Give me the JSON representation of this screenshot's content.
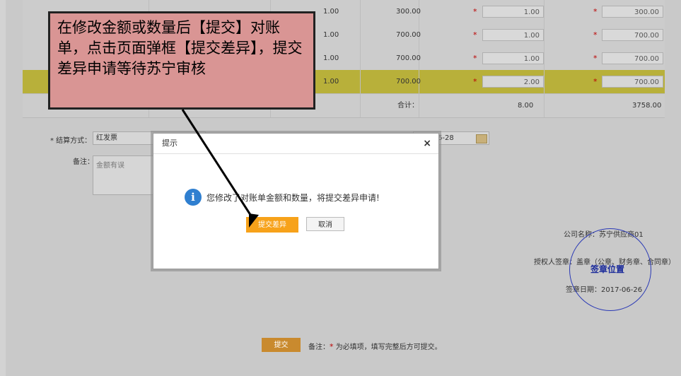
{
  "table": {
    "rows": [
      {
        "qty": "1.00",
        "amount": "300.00",
        "qty_input": "1.00",
        "amount_input": "300.00",
        "highlight": false
      },
      {
        "qty": "1.00",
        "amount": "700.00",
        "qty_input": "1.00",
        "amount_input": "700.00",
        "highlight": false
      },
      {
        "qty": "1.00",
        "amount": "700.00",
        "qty_input": "1.00",
        "amount_input": "700.00",
        "highlight": false
      },
      {
        "qty": "1.00",
        "amount": "700.00",
        "qty_input": "2.00",
        "amount_input": "700.00",
        "highlight": true
      }
    ],
    "total_label": "合计：",
    "total_qty": "8.00",
    "total_amount": "3758.00",
    "required_mark": "*"
  },
  "form": {
    "settle_label": "* 结算方式：",
    "settle_value": "红发票",
    "date_value": "6-28",
    "remark_label": "备注：",
    "remark_value": "金额有误"
  },
  "company": {
    "name_label": "公司名称：苏宁供应商01",
    "sign_label": "授权人签章：盖章（公章、财务章、合同章）",
    "seal_text": "签章位置",
    "sign_date": "签章日期：2017-06-26"
  },
  "footer": {
    "submit_label": "提交",
    "note_label": "备注：",
    "note_required": "*",
    "note_text": "为必填项，填写完整后方可提交。"
  },
  "dialog": {
    "title": "提示",
    "close": "×",
    "icon": "info-icon",
    "message": "您修改了对账单金额和数量，将提交差异申请!",
    "primary_label": "提交差异",
    "cancel_label": "取消"
  },
  "callout": {
    "text": "在修改金额或数量后【提交】对账单，点击页面弹框【提交差异】，提交差异申请等待苏宁审核"
  },
  "colors": {
    "highlight_row": "#b8b03a",
    "primary_button": "#f7a21a",
    "callout_bg": "#d99594",
    "seal": "#2a39b5"
  }
}
